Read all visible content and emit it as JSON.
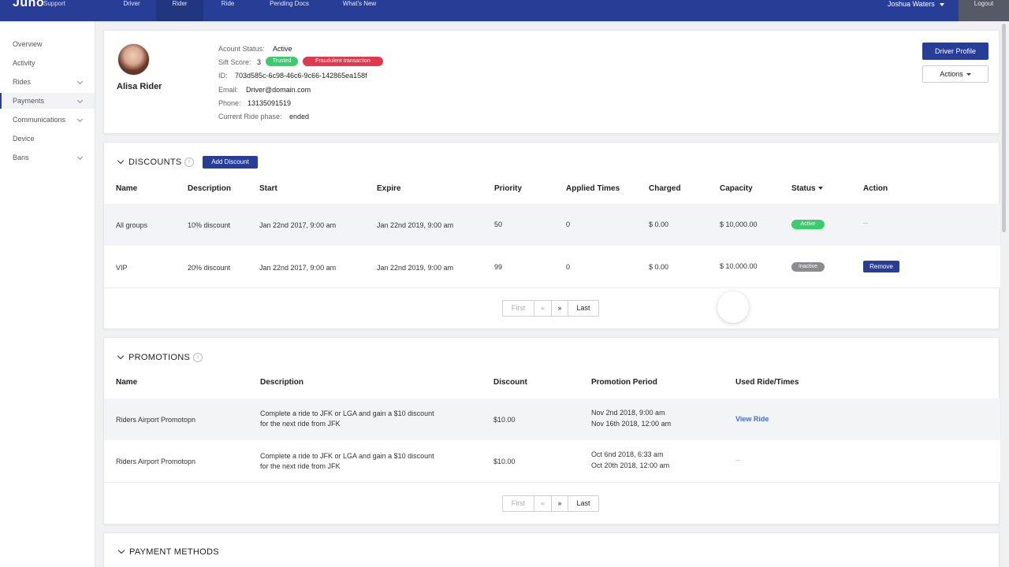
{
  "header": {
    "brand": "Juno",
    "brand_sub": "Support",
    "tabs": [
      {
        "label": "Driver"
      },
      {
        "label": "Rider"
      },
      {
        "label": "Ride"
      },
      {
        "label": "Pending Docs"
      },
      {
        "label": "What's New"
      }
    ],
    "user": "Joshua Waters",
    "logout": "Logout"
  },
  "sidebar": {
    "items": [
      {
        "label": "Overview"
      },
      {
        "label": "Activity"
      },
      {
        "label": "Rides"
      },
      {
        "label": "Payments"
      },
      {
        "label": "Communications"
      },
      {
        "label": "Device"
      },
      {
        "label": "Bans"
      }
    ]
  },
  "profile": {
    "name": "Alisa Rider",
    "status_label": "Acount Status:",
    "status_value": "Active",
    "sift_label": "Sift Score:",
    "sift_value": "3",
    "badge_trusted": "Trusted",
    "badge_fraud": "Fraudulent transaction",
    "id_label": "ID:",
    "id_value": "703d585c-6c98-46c6-9c66-142865ea158f",
    "email_label": "Email:",
    "email_value": "Driver@domain.com",
    "phone_label": "Phone:",
    "phone_value": "13135091519",
    "phase_label": "Current Ride phase:",
    "phase_value": "ended",
    "driver_profile_btn": "Driver Profile",
    "actions_btn": "Actions"
  },
  "discounts": {
    "title": "DISCOUNTS",
    "info": "i",
    "add_btn": "Add Discount",
    "columns": {
      "name": "Name",
      "description": "Description",
      "start": "Start",
      "expire": "Expire",
      "priority": "Priority",
      "applied": "Applied Times",
      "charged": "Charged",
      "capacity": "Capacity",
      "status": "Status",
      "action": "Action"
    },
    "rows": [
      {
        "name": "All groups",
        "description": "10% discount",
        "start": "Jan 22nd 2017, 9:00 am",
        "expire": "Jan 22nd 2019, 9:00 am",
        "priority": "50",
        "applied": "0",
        "charged": "$ 0.00",
        "capacity": "$ 10,000.00",
        "status": "Active",
        "action": "--"
      },
      {
        "name": "VIP",
        "description": "20% discount",
        "start": "Jan 22nd 2017, 9:00 am",
        "expire": "Jan 22nd 2019, 9:00 am",
        "priority": "99",
        "applied": "0",
        "charged": "$ 0.00",
        "capacity": "$ 10,000.00",
        "status": "Inactive",
        "action": "Remove"
      }
    ],
    "pager": {
      "first": "First",
      "prev": "«",
      "next": "»",
      "last": "Last"
    }
  },
  "promotions": {
    "title": "PROMOTIONS",
    "info": "i",
    "columns": {
      "name": "Name",
      "description": "Description",
      "discount": "Discount",
      "period": "Promotion Period",
      "used": "Used Ride/Times"
    },
    "rows": [
      {
        "name": "Riders Airport Promotopn",
        "desc_line1": "Complete a ride to JFK or LGA and gain a $10 discount",
        "desc_line2": "for the next ride from JFK",
        "discount": "$10.00",
        "period_start": "Nov 2nd 2018, 9:00 am",
        "period_end": "Nov 16th 2018, 12:00 am",
        "used": "View Ride"
      },
      {
        "name": "Riders Airport Promotopn",
        "desc_line1": "Complete a ride to JFK or LGA and gain a $10 discount",
        "desc_line2": "for the next ride from JFK",
        "discount": "$10.00",
        "period_start": "Oct 6nd 2018, 6:33 am",
        "period_end": "Oct 20th 2018, 12:00 am",
        "used": "--"
      }
    ],
    "pager": {
      "first": "First",
      "prev": "«",
      "next": "»",
      "last": "Last"
    }
  },
  "payment_methods": {
    "title": "PAYMENT METHODS"
  },
  "colors": {
    "nav": "#283e96",
    "trusted": "#3ccb6e",
    "fraud": "#e0384d",
    "active": "#3ccb6e",
    "inactive": "#8a8c91",
    "link": "#3f6fd1"
  }
}
